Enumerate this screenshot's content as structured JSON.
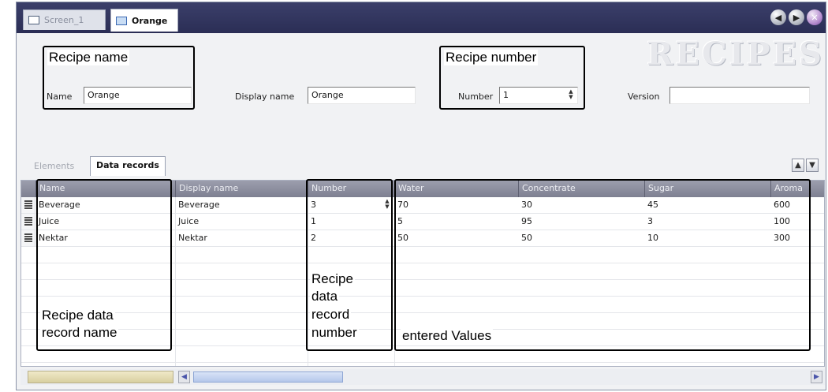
{
  "titlebar": {
    "tabs": [
      {
        "label": "Screen_1"
      },
      {
        "label": "Orange"
      }
    ]
  },
  "page_title": "RECIPES",
  "recipe": {
    "name_label": "Name",
    "name_value": "Orange",
    "display_name_label": "Display name",
    "display_name_value": "Orange",
    "number_label": "Number",
    "number_value": "1",
    "version_label": "Version",
    "version_value": ""
  },
  "inner_tabs": [
    {
      "label": "Elements"
    },
    {
      "label": "Data records"
    }
  ],
  "grid": {
    "columns": [
      "Name",
      "Display name",
      "Number",
      "Water",
      "Concentrate",
      "Sugar",
      "Aroma"
    ],
    "rows": [
      {
        "name": "Beverage",
        "display_name": "Beverage",
        "number": "3",
        "water": "70",
        "concentrate": "30",
        "sugar": "45",
        "aroma": "600"
      },
      {
        "name": "Juice",
        "display_name": "Juice",
        "number": "1",
        "water": "5",
        "concentrate": "95",
        "sugar": "3",
        "aroma": "100"
      },
      {
        "name": "Nektar",
        "display_name": "Nektar",
        "number": "2",
        "water": "50",
        "concentrate": "50",
        "sugar": "10",
        "aroma": "300"
      }
    ]
  },
  "annotations": {
    "recipe_name": "Recipe name",
    "recipe_number": "Recipe number",
    "record_name_line1": "Recipe data",
    "record_name_line2": "record name",
    "record_number_line1": "Recipe",
    "record_number_line2": "data",
    "record_number_line3": "record",
    "record_number_line4": "number",
    "entered_values": "entered Values"
  },
  "icons": {
    "prev": "arrow-left-icon",
    "next": "arrow-right-icon",
    "close": "close-icon",
    "move_up": "arrow-up-icon",
    "move_down": "arrow-down-icon"
  }
}
